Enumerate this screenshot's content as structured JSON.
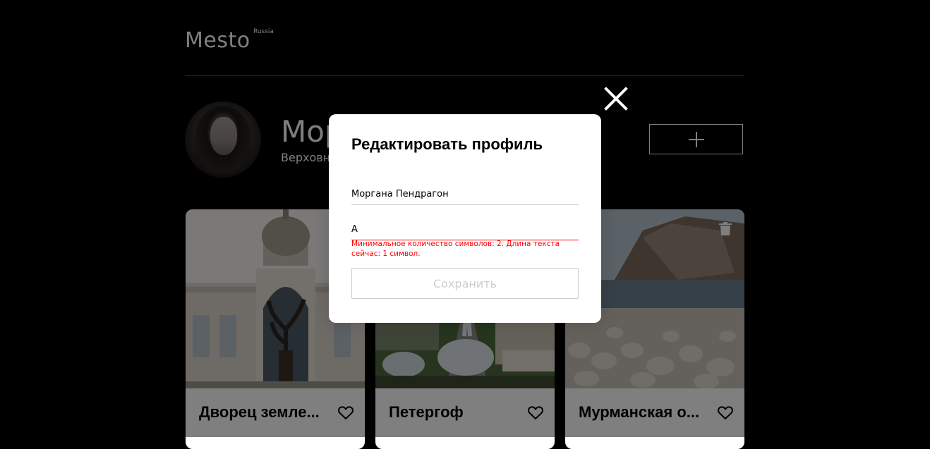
{
  "header": {
    "logo": "Mesto",
    "region": "Russia"
  },
  "profile": {
    "name": "Моргана Пендрагон",
    "about": "Верховная жрица Альбиона"
  },
  "cards": [
    {
      "title": "Дворец земледельцев",
      "title_visible": "Дворец земле..."
    },
    {
      "title": "Петергоф"
    },
    {
      "title": "Мурманская область",
      "title_visible": "Мурманская о..."
    }
  ],
  "modal": {
    "title": "Редактировать профиль",
    "name_value": "Моргана Пендрагон",
    "about_value": "А",
    "about_error": "Минимальное количество символов: 2. Длина текста сейчас: 1 символ.",
    "save_label": "Сохранить"
  },
  "colors": {
    "background": "#000000",
    "error": "#ff0000",
    "overlay": "rgba(0,0,0,0.5)"
  }
}
